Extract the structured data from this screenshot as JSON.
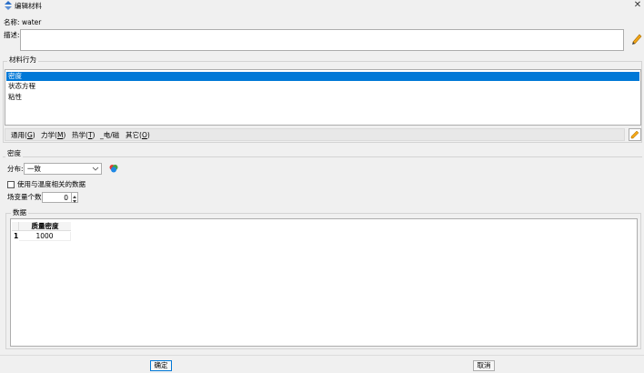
{
  "window": {
    "title": "编辑材料",
    "close_glyph": "✕"
  },
  "name_label": "名称:",
  "name_value": "water",
  "description": {
    "label": "描述:",
    "value": ""
  },
  "material_behaviors": {
    "group_title": "材料行为",
    "items": [
      {
        "label": "密度",
        "selected": true
      },
      {
        "label": "状态方程",
        "selected": false
      },
      {
        "label": "粘性",
        "selected": false
      }
    ]
  },
  "menu": [
    {
      "label": "通用(",
      "key": "G",
      "end": ")"
    },
    {
      "label": "力学(",
      "key": "M",
      "end": ")"
    },
    {
      "label": "热学(",
      "key": "T",
      "end": ")"
    },
    {
      "label": "_电/磁",
      "key": "",
      "end": ""
    },
    {
      "label": "其它(",
      "key": "O",
      "end": ")"
    }
  ],
  "density": {
    "group_title": "密度",
    "distribution_label": "分布:",
    "distribution_value": "一致",
    "temp_dependent_label": "使用与温度相关的数据",
    "temp_dependent_checked": false,
    "field_vars_label": "场变量个数:",
    "field_vars_value": "0"
  },
  "data": {
    "group_title": "数据",
    "column_header": "质量密度",
    "rows": [
      {
        "index": "1",
        "value": "1000"
      }
    ]
  },
  "buttons": {
    "ok": "确定",
    "cancel": "取消"
  },
  "colors": {
    "selection": "#0078d7",
    "background": "#f0f0f0"
  }
}
